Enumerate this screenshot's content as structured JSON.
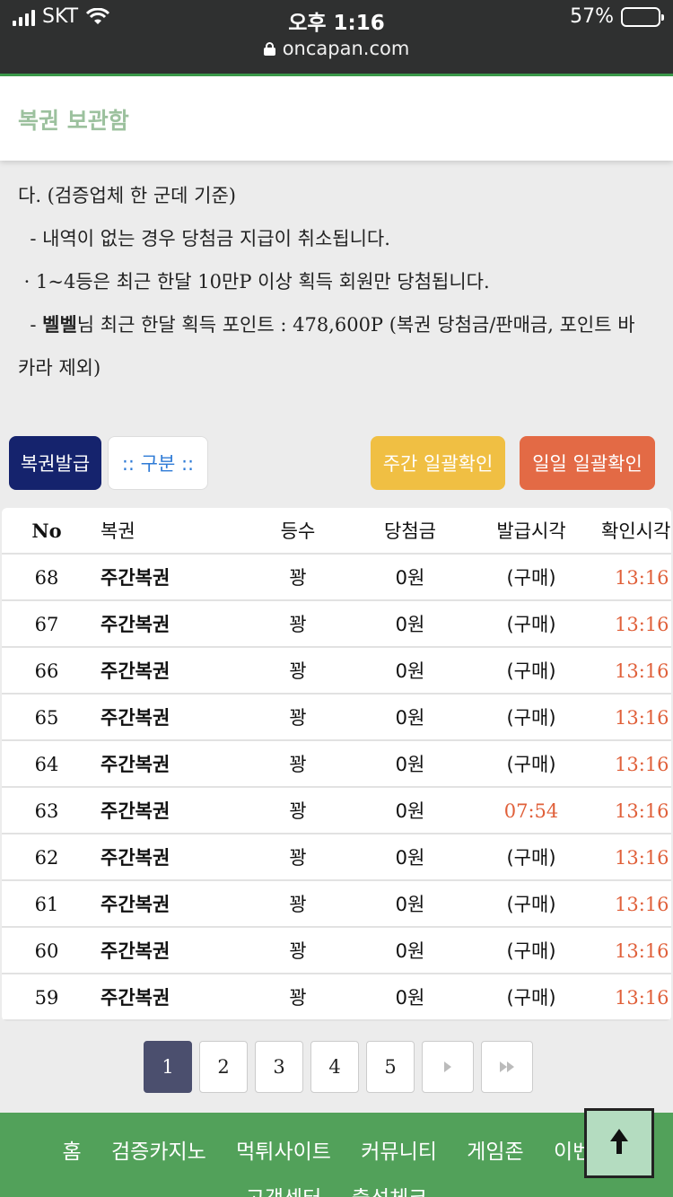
{
  "status_bar": {
    "carrier": "SKT",
    "time": "오후 1:16",
    "battery": "57%",
    "battery_level": 0.57
  },
  "browser": {
    "url": "oncapan.com"
  },
  "header": {
    "title": "복권 보관함"
  },
  "notice": {
    "line1": "다. (검증업체 한 군데 기준)",
    "line2": "  - 내역이 없는 경우 당첨금 지급이 취소됩니다.",
    "line3": " · 1~4등은 최근 한달 10만P 이상 획득 회원만 당첨됩니다.",
    "line4_prefix": "  - ",
    "line4_user": "벨벨",
    "line4_text": "님 최근 한달 획득 포인트 : 478,600P (복권 당첨금/판매금, 포인트 바",
    "line5": "카라 제외)"
  },
  "buttons": {
    "issue": "복권발급",
    "category": ":: 구분 ::",
    "weekly": "주간 일괄확인",
    "daily": "일일 일괄확인"
  },
  "table": {
    "headers": {
      "no": "No",
      "name": "복권",
      "rank": "등수",
      "prize": "당첨금",
      "issued": "발급시각",
      "confirmed": "확인시각"
    },
    "rows": [
      {
        "no": "68",
        "name": "주간복권",
        "rank": "꽝",
        "prize": "0원",
        "issued": "(구매)",
        "confirmed": "13:16"
      },
      {
        "no": "67",
        "name": "주간복권",
        "rank": "꽝",
        "prize": "0원",
        "issued": "(구매)",
        "confirmed": "13:16"
      },
      {
        "no": "66",
        "name": "주간복권",
        "rank": "꽝",
        "prize": "0원",
        "issued": "(구매)",
        "confirmed": "13:16"
      },
      {
        "no": "65",
        "name": "주간복권",
        "rank": "꽝",
        "prize": "0원",
        "issued": "(구매)",
        "confirmed": "13:16"
      },
      {
        "no": "64",
        "name": "주간복권",
        "rank": "꽝",
        "prize": "0원",
        "issued": "(구매)",
        "confirmed": "13:16"
      },
      {
        "no": "63",
        "name": "주간복권",
        "rank": "꽝",
        "prize": "0원",
        "issued": "07:54",
        "confirmed": "13:16"
      },
      {
        "no": "62",
        "name": "주간복권",
        "rank": "꽝",
        "prize": "0원",
        "issued": "(구매)",
        "confirmed": "13:16"
      },
      {
        "no": "61",
        "name": "주간복권",
        "rank": "꽝",
        "prize": "0원",
        "issued": "(구매)",
        "confirmed": "13:16"
      },
      {
        "no": "60",
        "name": "주간복권",
        "rank": "꽝",
        "prize": "0원",
        "issued": "(구매)",
        "confirmed": "13:16"
      },
      {
        "no": "59",
        "name": "주간복권",
        "rank": "꽝",
        "prize": "0원",
        "issued": "(구매)",
        "confirmed": "13:16"
      }
    ]
  },
  "pagination": {
    "pages": [
      "1",
      "2",
      "3",
      "4",
      "5"
    ],
    "current": "1"
  },
  "footer": {
    "nav": [
      "홈",
      "검증카지노",
      "먹튀사이트",
      "커뮤니티",
      "게임존",
      "이벤트"
    ],
    "nav2": [
      "고객센터",
      "출석체크"
    ]
  },
  "icons": {
    "scroll_top": "arrow-up-icon",
    "next": "chevron-right-icon",
    "last": "double-chevron-right-icon"
  }
}
